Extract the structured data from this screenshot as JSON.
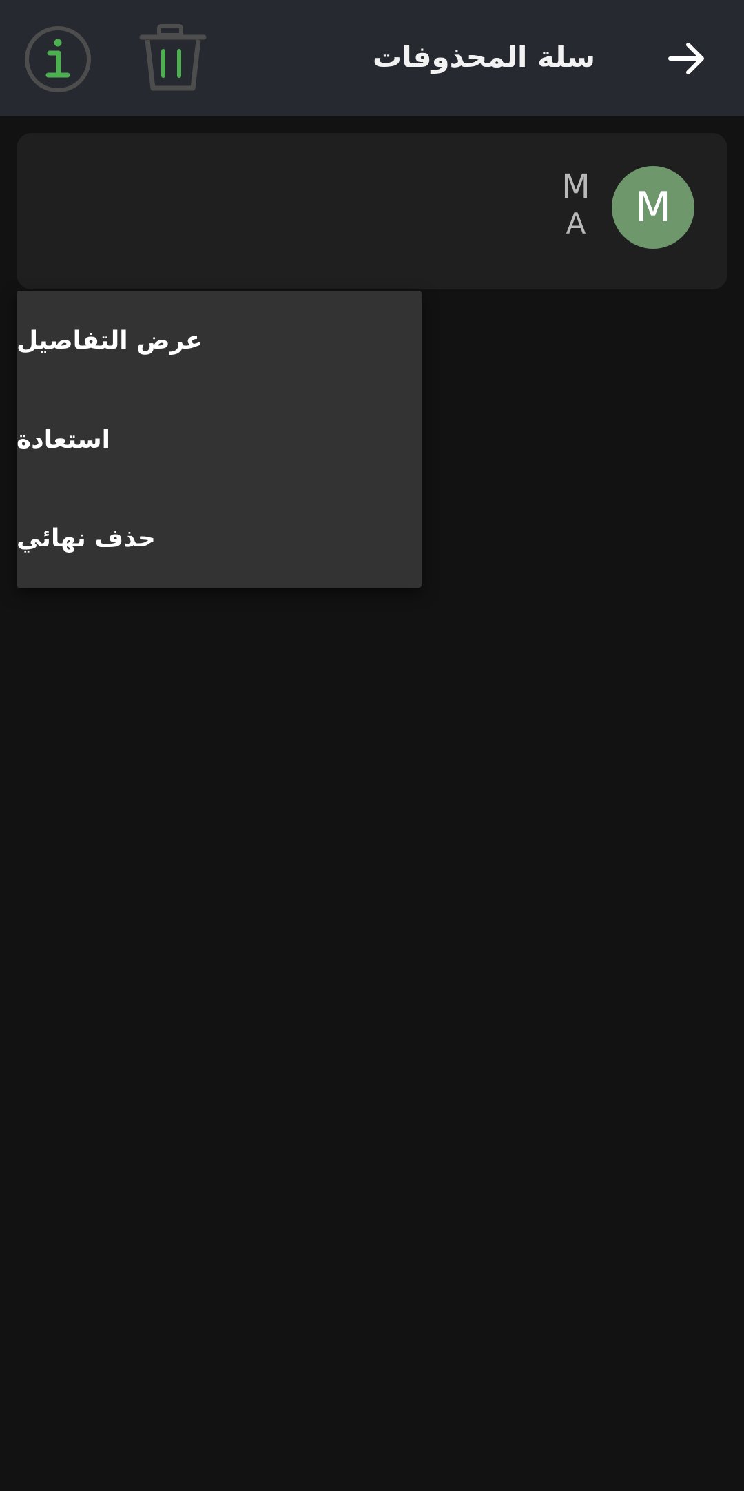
{
  "header": {
    "title": "سلة المحذوفات",
    "back_icon": "arrow-right-icon",
    "trash_icon": "trash-icon",
    "info_icon": "info-icon"
  },
  "contact": {
    "avatar_letter": "M",
    "initial_primary": "M",
    "initial_secondary": "A"
  },
  "menu": {
    "items": [
      {
        "label": "عرض التفاصيل"
      },
      {
        "label": "استعادة"
      },
      {
        "label": "حذف نهائي"
      }
    ]
  },
  "colors": {
    "background": "#121212",
    "app_bar": "#262a30",
    "card": "#1f1f1f",
    "menu": "#333333",
    "avatar": "#6e976c",
    "accent_green": "#4caf50",
    "icon_gray": "#4d4d4d"
  }
}
